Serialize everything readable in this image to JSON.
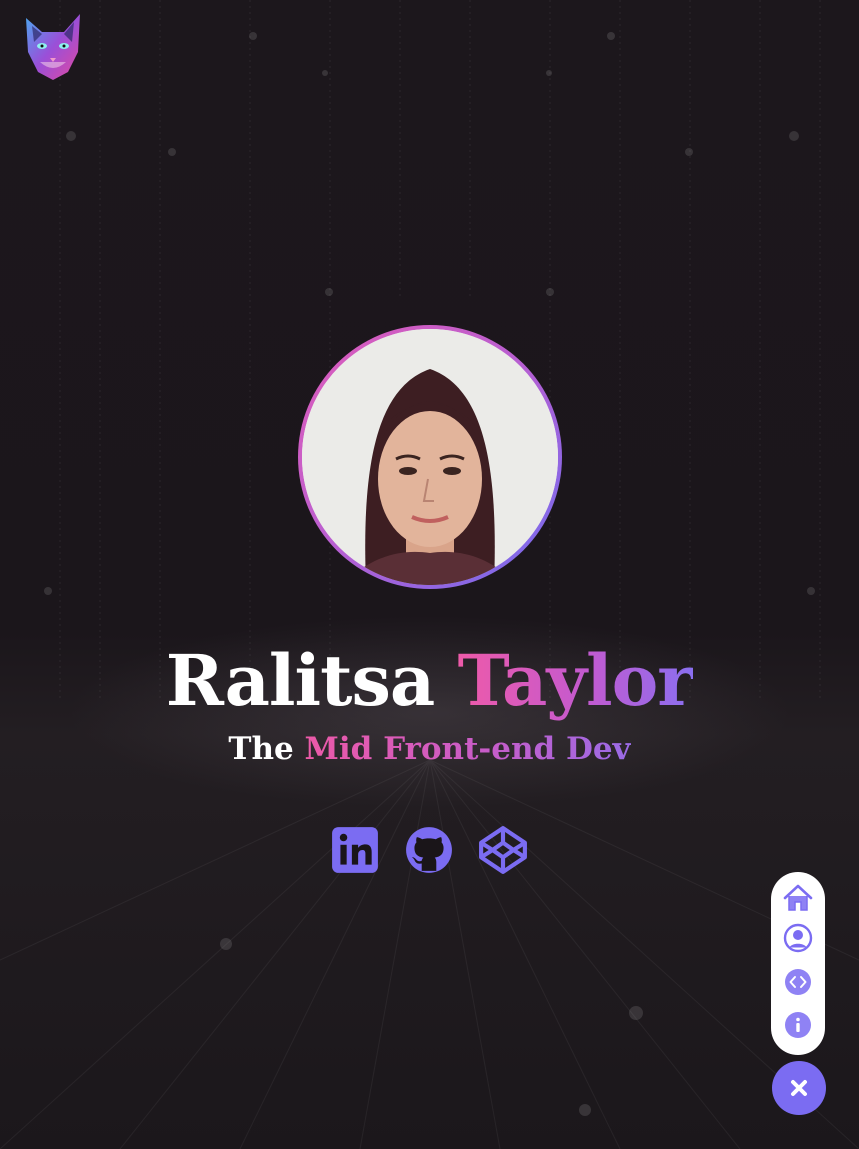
{
  "header": {
    "logo_icon": "cat-head-logo-icon"
  },
  "profile": {
    "photo_icon": "profile-photo",
    "first_name": "Ralitsa",
    "last_name": "Taylor",
    "subtitle_prefix": "The",
    "subtitle_role": "Mid Front-end Dev"
  },
  "socials": [
    {
      "icon": "linkedin-icon"
    },
    {
      "icon": "github-icon"
    },
    {
      "icon": "codepen-icon"
    }
  ],
  "nav": {
    "items": [
      {
        "icon": "home-icon"
      },
      {
        "icon": "user-circle-icon"
      },
      {
        "icon": "code-icon"
      },
      {
        "icon": "info-icon"
      }
    ],
    "toggle_icon": "close-icon"
  },
  "colors": {
    "accent_pink": "#ee5aa9",
    "accent_purple": "#8a6ff0",
    "icon_purple": "#7b6cf2",
    "background": "#1a1519"
  }
}
